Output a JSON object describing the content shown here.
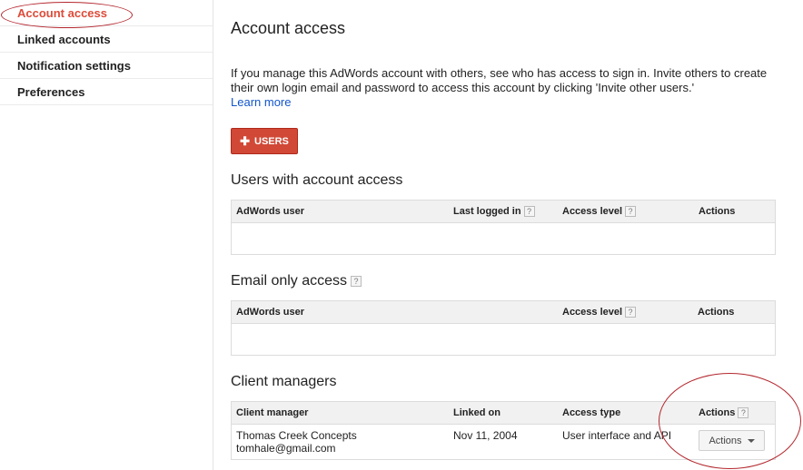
{
  "sidebar": {
    "items": [
      {
        "label": "Account access",
        "active": true
      },
      {
        "label": "Linked accounts",
        "active": false
      },
      {
        "label": "Notification settings",
        "active": false
      },
      {
        "label": "Preferences",
        "active": false
      }
    ]
  },
  "main": {
    "title": "Account access",
    "intro": "If you manage this AdWords account with others, see who has access to sign in. Invite others to create their own login email and password to access this account by clicking 'Invite other users.'",
    "learn_more": "Learn more",
    "add_users_label": "USERS",
    "help_glyph": "?",
    "users_section": {
      "title": "Users with account access",
      "columns": [
        "AdWords user",
        "Last logged in",
        "Access level",
        "Actions"
      ]
    },
    "email_section": {
      "title": "Email only access",
      "columns": [
        "AdWords user",
        "Access level",
        "Actions"
      ]
    },
    "client_section": {
      "title": "Client managers",
      "columns": [
        "Client manager",
        "Linked on",
        "Access type",
        "Actions"
      ],
      "rows": [
        {
          "name": "Thomas Creek Concepts",
          "email": "tomhale@gmail.com",
          "linked_on": "Nov 11, 2004",
          "access_type": "User interface and API",
          "action_label": "Actions"
        }
      ]
    }
  },
  "colors": {
    "accent_red": "#d14836",
    "active_nav": "#dd4b39",
    "link_blue": "#1155cc",
    "annotation_ellipse": "#b3262d"
  }
}
